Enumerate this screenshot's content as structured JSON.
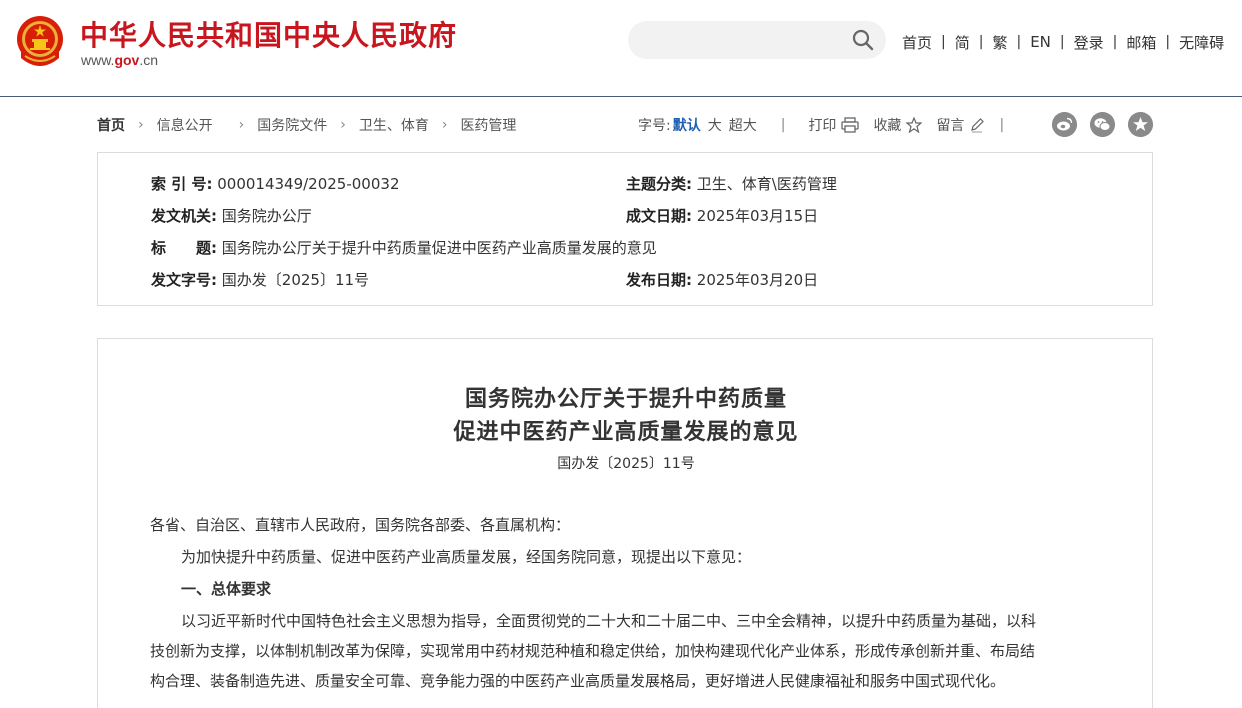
{
  "header": {
    "site_title": "中华人民共和国中央人民政府",
    "site_url_prefix": "www.",
    "site_url_brand": "gov",
    "site_url_suffix": ".cn",
    "search_placeholder": "",
    "nav": [
      "首页",
      "简",
      "繁",
      "EN",
      "登录",
      "邮箱",
      "无障碍"
    ],
    "nav_separator": "|",
    "accent_color": "#c8161e"
  },
  "breadcrumb": {
    "items": [
      "首页",
      "信息公开",
      "国务院文件",
      "卫生、体育",
      "医药管理"
    ],
    "separator": "›"
  },
  "tools": {
    "font_size_label": "字号:",
    "font_default": "默认",
    "font_large": "大",
    "font_xlarge": "超大",
    "divider": "|",
    "print": "打印",
    "favorite": "收藏",
    "comment": "留言",
    "icons": [
      "print-icon",
      "star-icon",
      "pencil-icon",
      "weibo-icon",
      "wechat-icon",
      "more-icon"
    ]
  },
  "meta": {
    "index_no_label": "索 引 号:",
    "index_no": "000014349/2025-00032",
    "category_label": "主题分类:",
    "category": "卫生、体育\\医药管理",
    "issuer_label": "发文机关:",
    "issuer": "国务院办公厅",
    "written_date_label": "成文日期:",
    "written_date": "2025年03月15日",
    "title_label": "标　　题:",
    "title": "国务院办公厅关于提升中药质量促进中医药产业高质量发展的意见",
    "doc_no_label": "发文字号:",
    "doc_no": "国办发〔2025〕11号",
    "publish_date_label": "发布日期:",
    "publish_date": "2025年03月20日"
  },
  "article": {
    "title_line1": "国务院办公厅关于提升中药质量",
    "title_line2": "促进中医药产业高质量发展的意见",
    "doc_no": "国办发〔2025〕11号",
    "salutation": "各省、自治区、直辖市人民政府，国务院各部委、各直属机构：",
    "intro": "为加快提升中药质量、促进中医药产业高质量发展，经国务院同意，现提出以下意见：",
    "section1": "一、总体要求",
    "body_line1": "以习近平新时代中国特色社会主义思想为指导，全面贯彻党的二十大和二十届二中、三中全会精神，以提升中药质量为基础，以科",
    "body_line2": "技创新为支撑，以体制机制改革为保障，实现常用中药材规范种植和稳定供给，加快构建现代化产业体系，形成传承创新并重、布局结",
    "body_line3": "构合理、装备制造先进、质量安全可靠、竞争能力强的中医药产业高质量发展格局，更好增进人民健康福祉和服务中国式现代化。"
  }
}
